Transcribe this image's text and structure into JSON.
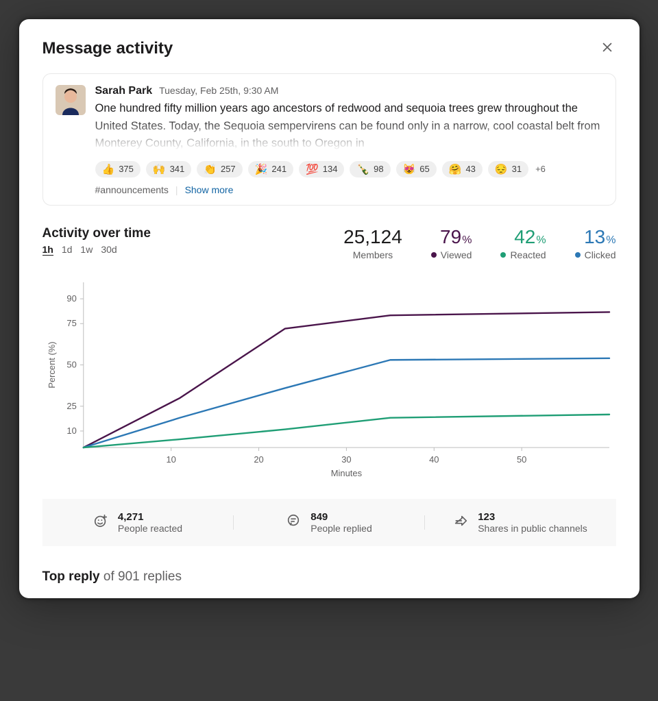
{
  "panel": {
    "title": "Message activity"
  },
  "message": {
    "author": "Sarah Park",
    "timestamp": "Tuesday, Feb 25th, 9:30 AM",
    "text": "One hundred fifty million years ago ancestors of redwood and sequoia trees grew throughout the United States. Today, the Sequoia sempervirens can be found only in a narrow, cool coastal belt from Monterey County, California, in the south to Oregon in",
    "channel": "#announcements",
    "show_more": "Show more",
    "reactions": [
      {
        "emoji": "👍",
        "count": 375
      },
      {
        "emoji": "🙌",
        "count": 341
      },
      {
        "emoji": "👏",
        "count": 257
      },
      {
        "emoji": "🎉",
        "count": 241
      },
      {
        "emoji": "💯",
        "count": 134
      },
      {
        "emoji": "🍾",
        "count": 98
      },
      {
        "emoji": "😻",
        "count": 65
      },
      {
        "emoji": "🤗",
        "count": 43
      },
      {
        "emoji": "😔",
        "count": 31
      }
    ],
    "reaction_overflow": "+6"
  },
  "activity": {
    "section_title": "Activity over time",
    "ranges": [
      "1h",
      "1d",
      "1w",
      "30d"
    ],
    "active_range": "1h",
    "members_value": "25,124",
    "members_label": "Members",
    "viewed_value": "79",
    "viewed_label": "Viewed",
    "reacted_value": "42",
    "reacted_label": "Reacted",
    "clicked_value": "13",
    "clicked_label": "Clicked",
    "pct_sign": "%"
  },
  "chart_data": {
    "type": "line",
    "xlabel": "Minutes",
    "ylabel": "Percent (%)",
    "xlim": [
      0,
      60
    ],
    "ylim": [
      0,
      100
    ],
    "x_ticks": [
      10,
      20,
      30,
      40,
      50
    ],
    "y_ticks": [
      10,
      25,
      50,
      75,
      90
    ],
    "x": [
      0,
      11,
      23,
      35,
      60
    ],
    "series": [
      {
        "name": "Viewed",
        "color": "#4a154b",
        "values": [
          0,
          30,
          72,
          80,
          82
        ]
      },
      {
        "name": "Clicked",
        "color": "#2c78b5",
        "values": [
          0,
          18,
          36,
          53,
          54
        ]
      },
      {
        "name": "Reacted",
        "color": "#1f9e75",
        "values": [
          0,
          5,
          11,
          18,
          20
        ]
      }
    ]
  },
  "summary": [
    {
      "icon": "add-reaction-icon",
      "value": "4,271",
      "label": "People reacted"
    },
    {
      "icon": "reply-icon",
      "value": "849",
      "label": "People replied"
    },
    {
      "icon": "share-icon",
      "value": "123",
      "label": "Shares in public channels"
    }
  ],
  "top_reply": {
    "strong": "Top reply",
    "rest": " of 901 replies"
  }
}
